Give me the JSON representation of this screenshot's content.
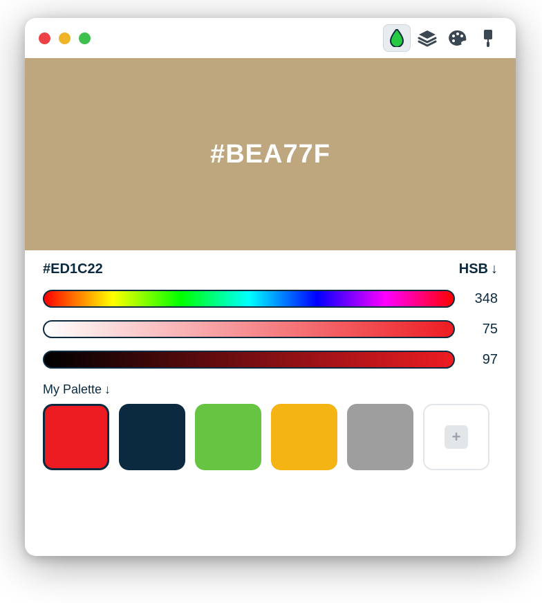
{
  "preview": {
    "color": "#BEA77F",
    "display_hex": "#BEA77F"
  },
  "readout": {
    "hex": "#ED1C22",
    "mode_label": "HSB"
  },
  "sliders": {
    "hue": {
      "value": "348"
    },
    "sat": {
      "value": "75",
      "gradient_from": "#FFFFFF",
      "gradient_to": "#ED1C22"
    },
    "bri": {
      "value": "97",
      "gradient_from": "#000000",
      "gradient_to": "#ED1C22"
    }
  },
  "palette": {
    "label": "My Palette",
    "swatches": [
      {
        "color": "#ED1C22",
        "selected": true
      },
      {
        "color": "#0B2A40",
        "selected": false
      },
      {
        "color": "#67C342",
        "selected": false
      },
      {
        "color": "#F4B514",
        "selected": false
      },
      {
        "color": "#9E9E9E",
        "selected": false
      }
    ]
  },
  "icons": {
    "drop": "drop-icon",
    "layers": "layers-icon",
    "paint": "palette-icon",
    "brush": "brush-icon"
  }
}
